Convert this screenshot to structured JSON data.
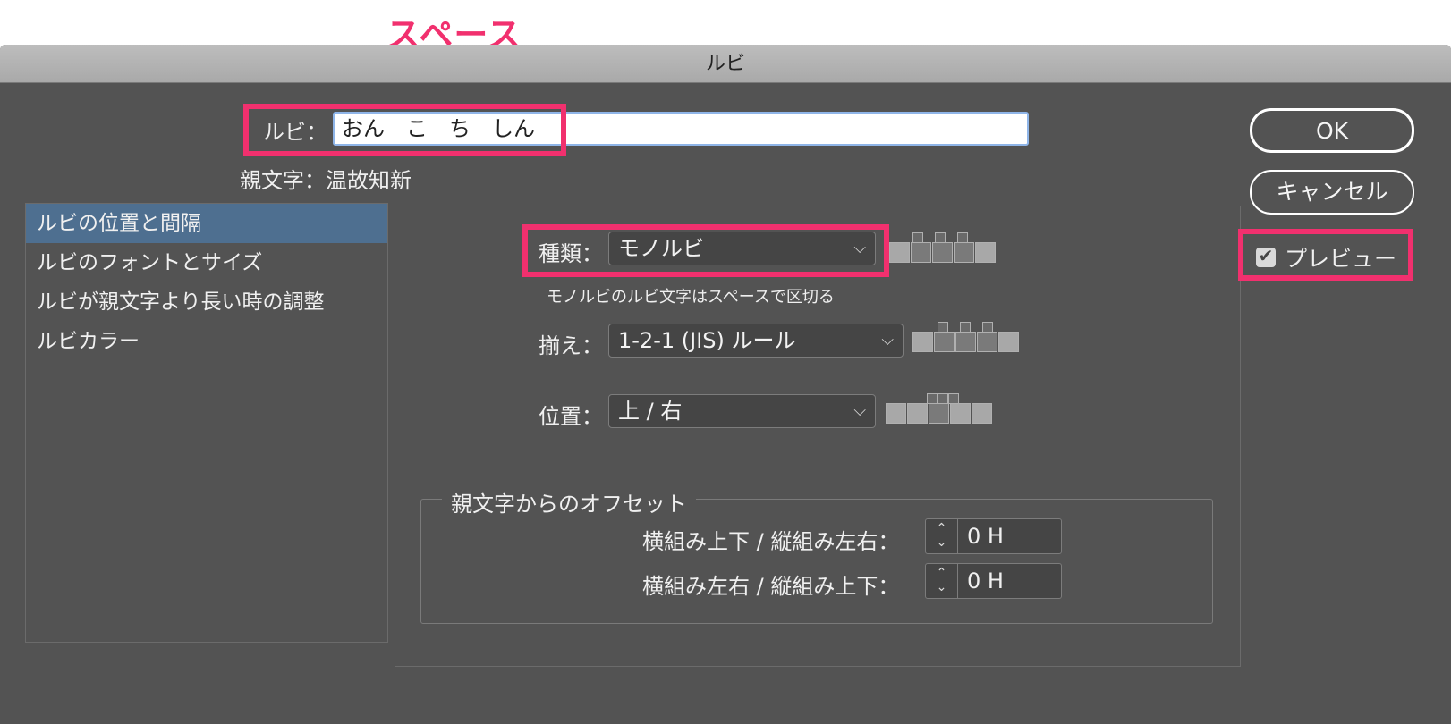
{
  "annotation": {
    "title": "スペース",
    "color": "#f1306e"
  },
  "dialog": {
    "title": "ルビ"
  },
  "ruby": {
    "label": "ルビ：",
    "value": "おん　こ　ち　しん"
  },
  "base_text": {
    "label": "親文字：",
    "value": "温故知新"
  },
  "sidebar": {
    "items": [
      {
        "label": "ルビの位置と間隔",
        "selected": true
      },
      {
        "label": "ルビのフォントとサイズ",
        "selected": false
      },
      {
        "label": "ルビが親文字より長い時の調整",
        "selected": false
      },
      {
        "label": "ルビカラー",
        "selected": false
      }
    ]
  },
  "type": {
    "label": "種類：",
    "value": "モノルビ",
    "note": "モノルビのルビ文字はスペースで区切る"
  },
  "alignment": {
    "label": "揃え：",
    "value": "1-2-1 (JIS) ルール"
  },
  "position": {
    "label": "位置：",
    "value": "上 / 右"
  },
  "offset": {
    "group_label": "親文字からのオフセット",
    "row1": {
      "label": "横組み上下 / 縦組み左右：",
      "value": "0 H"
    },
    "row2": {
      "label": "横組み左右 / 縦組み上下：",
      "value": "0 H"
    }
  },
  "buttons": {
    "ok": "OK",
    "cancel": "キャンセル"
  },
  "preview": {
    "label": "プレビュー",
    "checked": true
  }
}
